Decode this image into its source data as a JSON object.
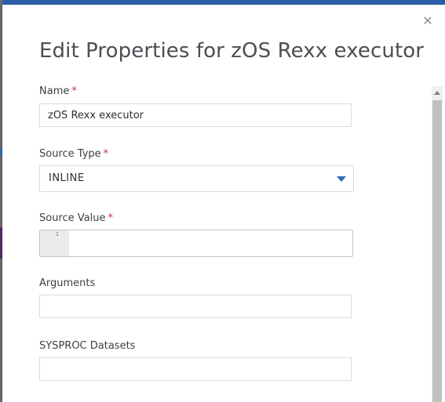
{
  "dialog": {
    "title": "Edit Properties for zOS Rexx executor",
    "close_icon": "close-icon"
  },
  "fields": {
    "name": {
      "label": "Name",
      "required": "*",
      "value": "zOS Rexx executor"
    },
    "source_type": {
      "label": "Source Type",
      "required": "*",
      "value": "INLINE",
      "icon": "chevron-down-icon"
    },
    "source_value": {
      "label": "Source Value",
      "required": "*",
      "line_number": "1"
    },
    "arguments": {
      "label": "Arguments",
      "value": ""
    },
    "sysproc": {
      "label": "SYSPROC Datasets",
      "value": ""
    }
  },
  "colors": {
    "accent": "#2f6ab6",
    "required": "#d32f2f",
    "header_bar": "#2a5ea8"
  }
}
